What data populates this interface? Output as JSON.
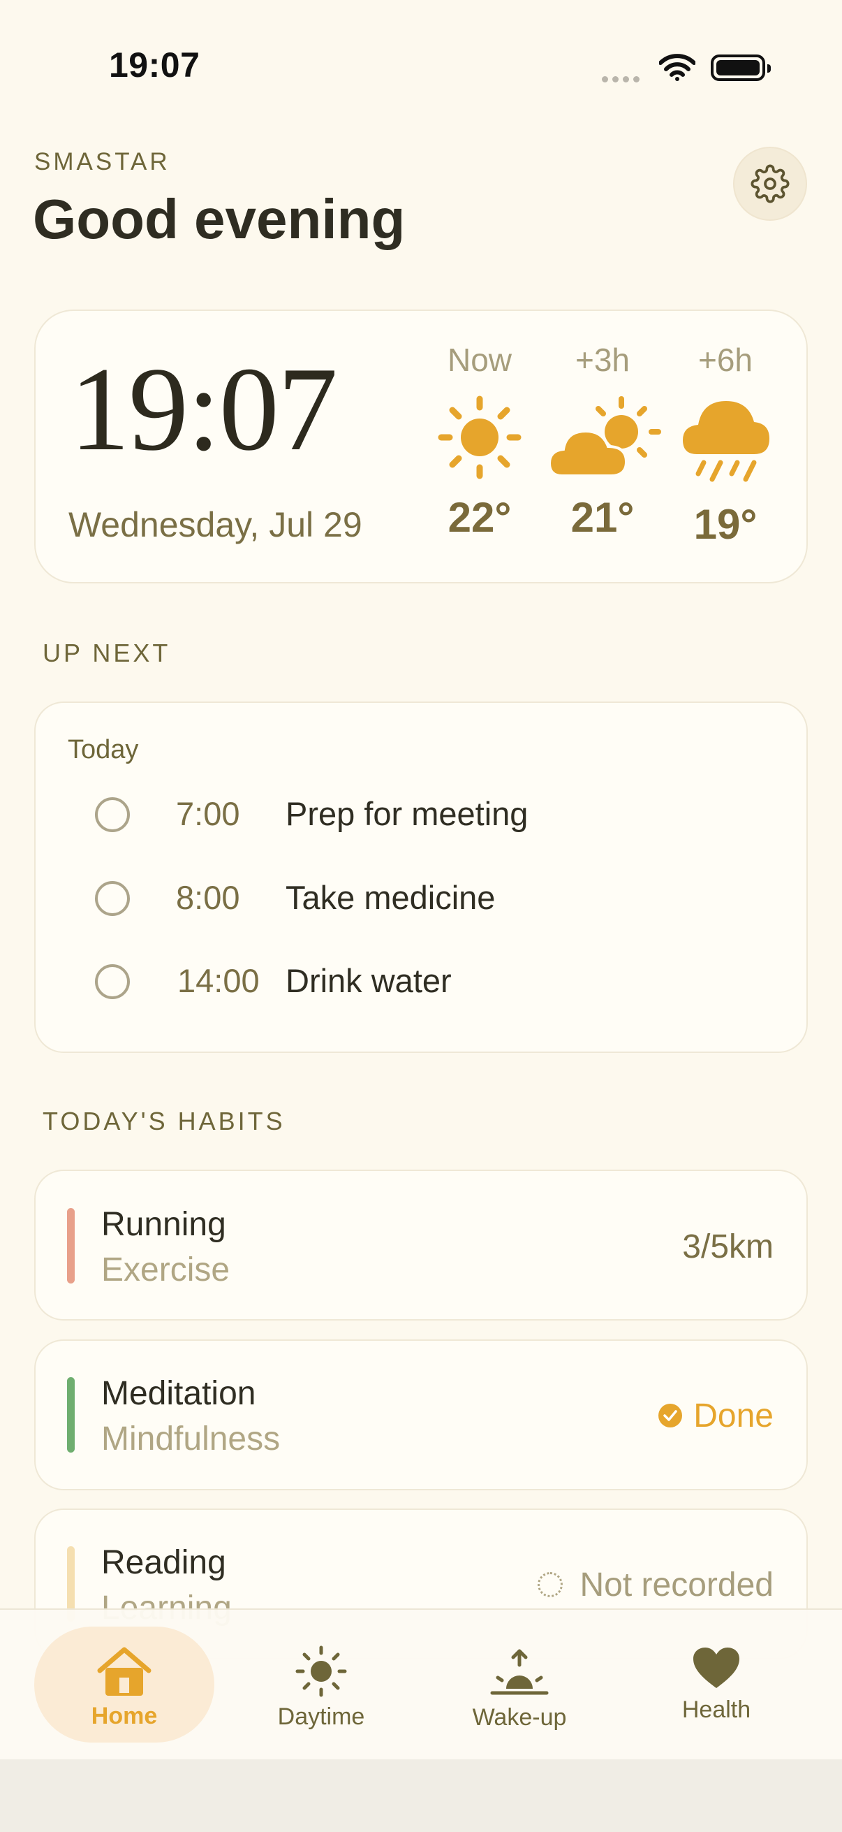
{
  "status_bar": {
    "time": "19:07"
  },
  "header": {
    "eyebrow": "SMASTAR",
    "greeting": "Good evening",
    "settings_icon": "gear-icon"
  },
  "clock_card": {
    "time": "19:07",
    "date": "Wednesday, Jul 29",
    "forecast": [
      {
        "label": "Now",
        "icon": "sun-icon",
        "temp": "22°"
      },
      {
        "label": "+3h",
        "icon": "partly-cloudy-icon",
        "temp": "21°"
      },
      {
        "label": "+6h",
        "icon": "rain-icon",
        "temp": "19°"
      }
    ]
  },
  "up_next": {
    "heading": "UP NEXT",
    "day": "Today",
    "tasks": [
      {
        "time": "7:00",
        "title": "Prep for meeting"
      },
      {
        "time": "8:00",
        "title": "Take medicine"
      },
      {
        "time": "14:00",
        "title": "Drink water"
      }
    ]
  },
  "habits": {
    "heading": "TODAY'S HABITS",
    "items": [
      {
        "name": "Running",
        "category": "Exercise",
        "status": "3/5km",
        "color": "#e8a08a"
      },
      {
        "name": "Meditation",
        "category": "Mindfulness",
        "status": "Done",
        "color": "#6fae6f"
      },
      {
        "name": "Reading",
        "category": "Learning",
        "status": "Not recorded",
        "color": "#f5dfb0"
      }
    ]
  },
  "tab_bar": {
    "active": "Home",
    "tabs": [
      {
        "label": "Home",
        "icon": "home-icon"
      },
      {
        "label": "Daytime",
        "icon": "sun-icon"
      },
      {
        "label": "Wake-up",
        "icon": "sunrise-icon"
      },
      {
        "label": "Health",
        "icon": "heart-icon"
      }
    ]
  },
  "colors": {
    "accent": "#e6a52c",
    "background": "#fdf9ee",
    "muted": "#6e6639"
  }
}
